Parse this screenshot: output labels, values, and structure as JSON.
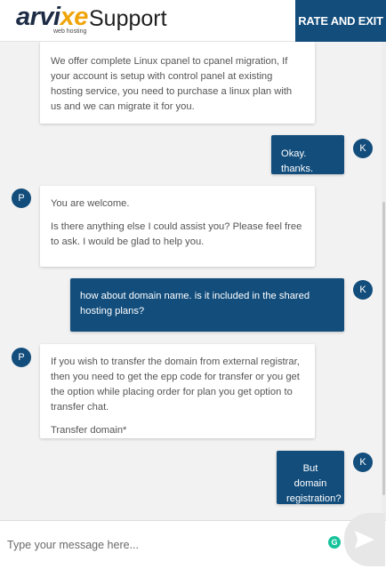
{
  "header": {
    "logo_text_1": "arvi",
    "logo_text_2": "xe",
    "logo_tagline": "web hosting",
    "title": "Support",
    "rate_exit_label": "RATE AND EXIT"
  },
  "messages": [
    {
      "sender": "agent",
      "paragraphs": [
        "We offer complete Linux cpanel to cpanel migration, If your account is setup with control panel at existing hosting service, you need to purchase a linux plan with us and we can migrate it for you."
      ]
    },
    {
      "sender": "user",
      "avatar": "K",
      "paragraphs": [
        "Okay. thanks."
      ]
    },
    {
      "sender": "agent",
      "avatar": "P",
      "paragraphs": [
        "You are welcome.",
        "Is there anything else I could assist you? Please feel free to ask. I would be glad to help you."
      ]
    },
    {
      "sender": "user",
      "avatar": "K",
      "paragraphs": [
        "how about domain name. is it included in the shared hosting plans?"
      ]
    },
    {
      "sender": "agent",
      "avatar": "P",
      "paragraphs": [
        "If you wish to transfer the domain from external registrar, then you need to get the epp code for transfer or you get the option while placing order for plan you get option to transfer chat.",
        "Transfer domain*"
      ]
    },
    {
      "sender": "user",
      "avatar": "K",
      "paragraphs": [
        "But domain registration?"
      ]
    }
  ],
  "composer": {
    "placeholder": "Type your message here...",
    "grammarly_badge": "G",
    "send_icon": "send-icon"
  },
  "colors": {
    "brand_blue": "#124d7c",
    "logo_accent": "#f0a40a",
    "grammarly_green": "#15c39a"
  }
}
